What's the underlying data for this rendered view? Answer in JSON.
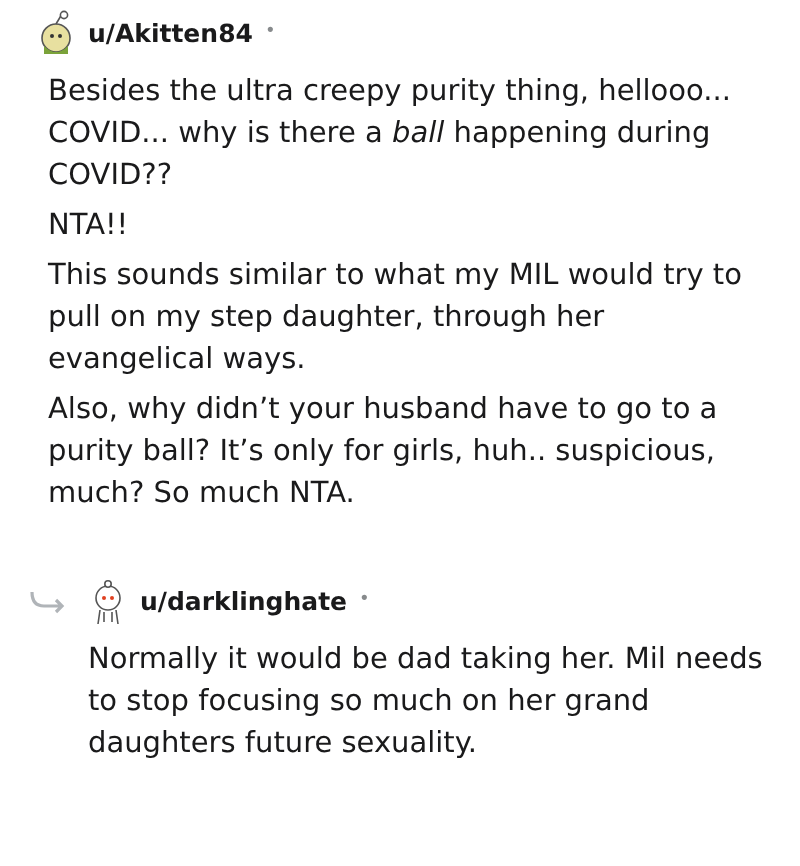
{
  "comments": [
    {
      "username": "u/Akitten84",
      "separator": "•",
      "paragraphs": [
        "Besides the ultra creepy purity thing, hellooo... COVID... why is there a *ball* happening during COVID??",
        "NTA!!",
        "This sounds similar to what my MIL would try to pull on my step daughter, through her evangelical ways.",
        "Also, why didn’t your husband have to go to a purity ball? It’s only for girls, huh.. suspicious, much? So much NTA."
      ]
    },
    {
      "username": "u/darklinghate",
      "separator": "•",
      "paragraphs": [
        "Normally it would be dad taking her. Mil needs to stop focusing so much on her grand daughters future sexuality."
      ]
    }
  ]
}
